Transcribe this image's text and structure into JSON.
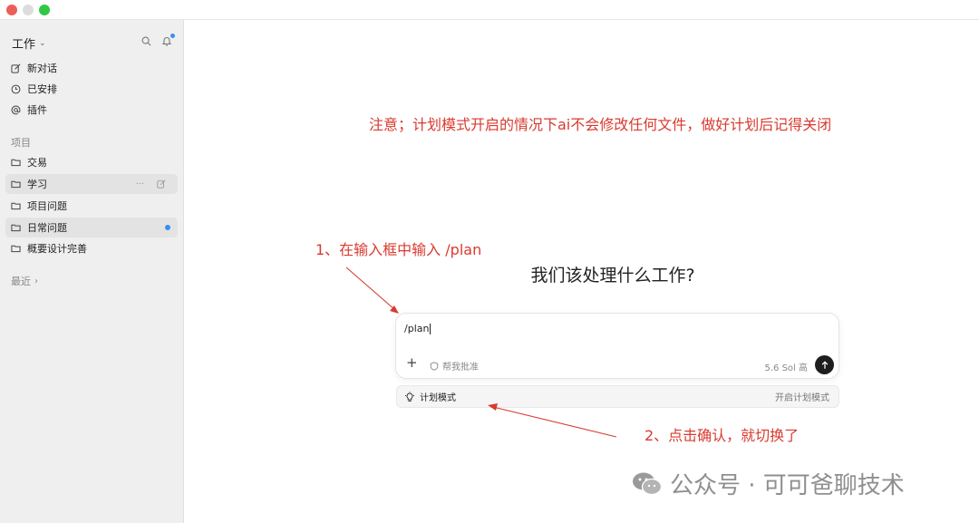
{
  "window": {
    "traffic_lights": [
      "close",
      "minimize",
      "maximize"
    ],
    "colors": {
      "close": "#ec5f57",
      "minimize": "#dcdcdc",
      "maximize": "#2fc844"
    }
  },
  "sidebar": {
    "workspace": "工作",
    "search_icon": "search-icon",
    "notification_icon": "bell-icon",
    "top_items": [
      {
        "label": "新对话",
        "icon": "new-chat-icon"
      },
      {
        "label": "已安排",
        "icon": "clock-icon"
      },
      {
        "label": "插件",
        "icon": "at-icon"
      }
    ],
    "projects_label": "项目",
    "projects": [
      {
        "label": "交易",
        "icon": "folder-icon"
      },
      {
        "label": "学习",
        "icon": "folder-icon"
      },
      {
        "label": "项目问题",
        "icon": "folder-icon"
      },
      {
        "label": "日常问题",
        "icon": "folder-icon"
      },
      {
        "label": "概要设计完善",
        "icon": "folder-icon"
      }
    ],
    "recent_label": "最近",
    "accent": "#3b8ff0"
  },
  "annotations": {
    "note": "注意；计划模式开启的情况下ai不会修改任何文件，做好计划后记得关闭",
    "step1": "1、在输入框中输入 /plan",
    "step2": "2、点击确认，就切换了",
    "color": "#d93a2f"
  },
  "main": {
    "heading": "我们该处理什么工作?",
    "composer": {
      "text": "/plan",
      "approve_label": "帮我批准",
      "model_label": "5.6 Sol  高"
    },
    "suggestion": {
      "label": "计划模式",
      "hint": "开启计划模式",
      "icon": "lightbulb-icon"
    }
  },
  "watermark": {
    "text": "公众号 · 可可爸聊技术",
    "icon": "wechat-icon"
  }
}
